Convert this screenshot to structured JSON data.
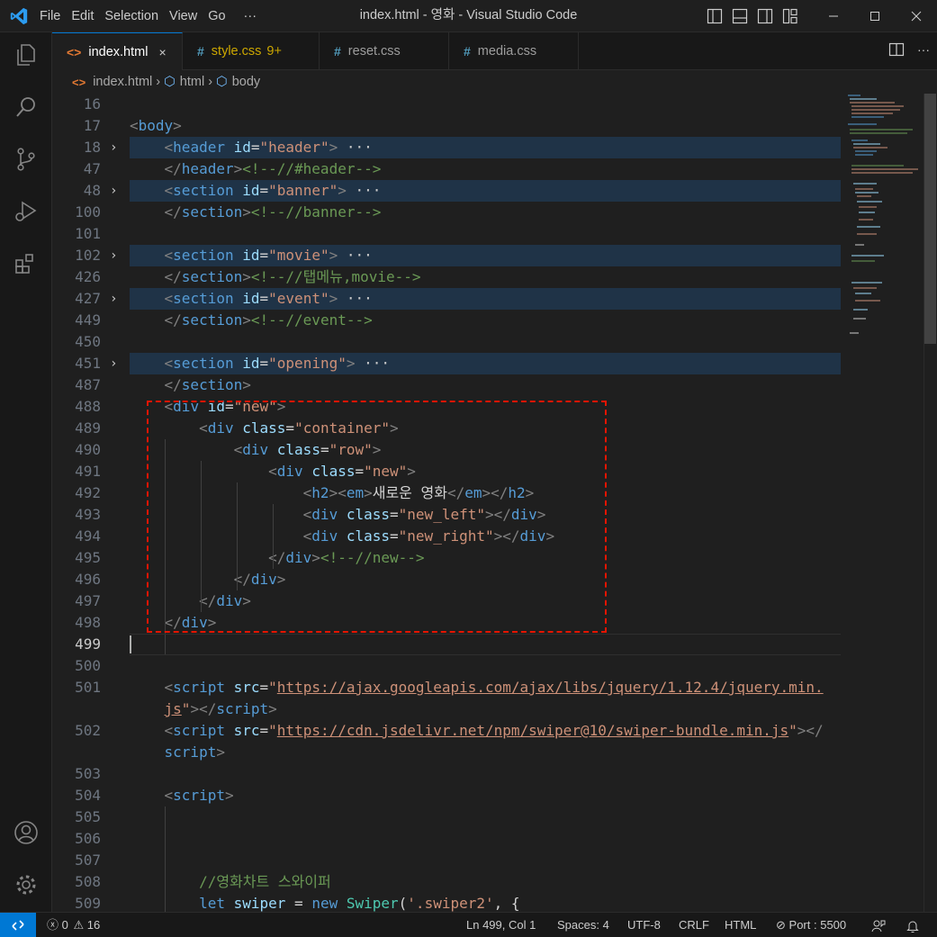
{
  "titlebar": {
    "menu": [
      "File",
      "Edit",
      "Selection",
      "View",
      "Go",
      "···"
    ],
    "title": "index.html - 영화 - Visual Studio Code"
  },
  "tabs": [
    {
      "label": "index.html",
      "icon": "<>",
      "active": true,
      "close": "×"
    },
    {
      "label": "style.css",
      "badge": "9+",
      "icon": "#",
      "active": false
    },
    {
      "label": "reset.css",
      "icon": "#",
      "active": false
    },
    {
      "label": "media.css",
      "icon": "#",
      "active": false
    }
  ],
  "breadcrumb": [
    "index.html",
    "html",
    "body"
  ],
  "lines": [
    {
      "n": "16",
      "parts": []
    },
    {
      "n": "17",
      "parts": [
        [
          "pu",
          "<"
        ],
        [
          "tg",
          "body"
        ],
        [
          "pu",
          ">"
        ]
      ]
    },
    {
      "n": "18",
      "fold": true,
      "folded": true,
      "parts": [
        [
          "tx",
          "    "
        ],
        [
          "pu",
          "<"
        ],
        [
          "tg",
          "header"
        ],
        [
          "tx",
          " "
        ],
        [
          "at",
          "id"
        ],
        [
          "tx",
          "="
        ],
        [
          "st",
          "\"header\""
        ],
        [
          "pu",
          ">"
        ],
        [
          "dots",
          " ···"
        ]
      ]
    },
    {
      "n": "47",
      "parts": [
        [
          "tx",
          "    "
        ],
        [
          "pu",
          "</"
        ],
        [
          "tg",
          "header"
        ],
        [
          "pu",
          ">"
        ],
        [
          "cm",
          "<!--//#header-->"
        ]
      ]
    },
    {
      "n": "48",
      "fold": true,
      "folded": true,
      "parts": [
        [
          "tx",
          "    "
        ],
        [
          "pu",
          "<"
        ],
        [
          "tg",
          "section"
        ],
        [
          "tx",
          " "
        ],
        [
          "at",
          "id"
        ],
        [
          "tx",
          "="
        ],
        [
          "st",
          "\"banner\""
        ],
        [
          "pu",
          ">"
        ],
        [
          "dots",
          " ···"
        ]
      ]
    },
    {
      "n": "100",
      "parts": [
        [
          "tx",
          "    "
        ],
        [
          "pu",
          "</"
        ],
        [
          "tg",
          "section"
        ],
        [
          "pu",
          ">"
        ],
        [
          "cm",
          "<!--//banner-->"
        ]
      ]
    },
    {
      "n": "101",
      "parts": []
    },
    {
      "n": "102",
      "fold": true,
      "folded": true,
      "parts": [
        [
          "tx",
          "    "
        ],
        [
          "pu",
          "<"
        ],
        [
          "tg",
          "section"
        ],
        [
          "tx",
          " "
        ],
        [
          "at",
          "id"
        ],
        [
          "tx",
          "="
        ],
        [
          "st",
          "\"movie\""
        ],
        [
          "pu",
          ">"
        ],
        [
          "dots",
          " ···"
        ]
      ]
    },
    {
      "n": "426",
      "parts": [
        [
          "tx",
          "    "
        ],
        [
          "pu",
          "</"
        ],
        [
          "tg",
          "section"
        ],
        [
          "pu",
          ">"
        ],
        [
          "cm",
          "<!--//탭메뉴,movie-->"
        ]
      ]
    },
    {
      "n": "427",
      "fold": true,
      "folded": true,
      "parts": [
        [
          "tx",
          "    "
        ],
        [
          "pu",
          "<"
        ],
        [
          "tg",
          "section"
        ],
        [
          "tx",
          " "
        ],
        [
          "at",
          "id"
        ],
        [
          "tx",
          "="
        ],
        [
          "st",
          "\"event\""
        ],
        [
          "pu",
          ">"
        ],
        [
          "dots",
          " ···"
        ]
      ]
    },
    {
      "n": "449",
      "parts": [
        [
          "tx",
          "    "
        ],
        [
          "pu",
          "</"
        ],
        [
          "tg",
          "section"
        ],
        [
          "pu",
          ">"
        ],
        [
          "cm",
          "<!--//event-->"
        ]
      ]
    },
    {
      "n": "450",
      "parts": []
    },
    {
      "n": "451",
      "fold": true,
      "folded": true,
      "parts": [
        [
          "tx",
          "    "
        ],
        [
          "pu",
          "<"
        ],
        [
          "tg",
          "section"
        ],
        [
          "tx",
          " "
        ],
        [
          "at",
          "id"
        ],
        [
          "tx",
          "="
        ],
        [
          "st",
          "\"opening\""
        ],
        [
          "pu",
          ">"
        ],
        [
          "dots",
          " ···"
        ]
      ]
    },
    {
      "n": "487",
      "parts": [
        [
          "tx",
          "    "
        ],
        [
          "pu",
          "</"
        ],
        [
          "tg",
          "section"
        ],
        [
          "pu",
          ">"
        ]
      ]
    },
    {
      "n": "488",
      "parts": [
        [
          "tx",
          "    "
        ],
        [
          "pu",
          "<"
        ],
        [
          "tg",
          "div"
        ],
        [
          "tx",
          " "
        ],
        [
          "at",
          "id"
        ],
        [
          "tx",
          "="
        ],
        [
          "st",
          "\"new\""
        ],
        [
          "pu",
          ">"
        ]
      ]
    },
    {
      "n": "489",
      "parts": [
        [
          "tx",
          "        "
        ],
        [
          "pu",
          "<"
        ],
        [
          "tg",
          "div"
        ],
        [
          "tx",
          " "
        ],
        [
          "at",
          "class"
        ],
        [
          "tx",
          "="
        ],
        [
          "st",
          "\"container\""
        ],
        [
          "pu",
          ">"
        ]
      ]
    },
    {
      "n": "490",
      "parts": [
        [
          "tx",
          "            "
        ],
        [
          "pu",
          "<"
        ],
        [
          "tg",
          "div"
        ],
        [
          "tx",
          " "
        ],
        [
          "at",
          "class"
        ],
        [
          "tx",
          "="
        ],
        [
          "st",
          "\"row\""
        ],
        [
          "pu",
          ">"
        ]
      ]
    },
    {
      "n": "491",
      "parts": [
        [
          "tx",
          "                "
        ],
        [
          "pu",
          "<"
        ],
        [
          "tg",
          "div"
        ],
        [
          "tx",
          " "
        ],
        [
          "at",
          "class"
        ],
        [
          "tx",
          "="
        ],
        [
          "st",
          "\"new\""
        ],
        [
          "pu",
          ">"
        ]
      ]
    },
    {
      "n": "492",
      "parts": [
        [
          "tx",
          "                    "
        ],
        [
          "pu",
          "<"
        ],
        [
          "tg",
          "h2"
        ],
        [
          "pu",
          "><"
        ],
        [
          "tg",
          "em"
        ],
        [
          "pu",
          ">"
        ],
        [
          "tx",
          "새로운 영화"
        ],
        [
          "pu",
          "</"
        ],
        [
          "tg",
          "em"
        ],
        [
          "pu",
          "></"
        ],
        [
          "tg",
          "h2"
        ],
        [
          "pu",
          ">"
        ]
      ]
    },
    {
      "n": "493",
      "parts": [
        [
          "tx",
          "                    "
        ],
        [
          "pu",
          "<"
        ],
        [
          "tg",
          "div"
        ],
        [
          "tx",
          " "
        ],
        [
          "at",
          "class"
        ],
        [
          "tx",
          "="
        ],
        [
          "st",
          "\"new_left\""
        ],
        [
          "pu",
          "></"
        ],
        [
          "tg",
          "div"
        ],
        [
          "pu",
          ">"
        ]
      ]
    },
    {
      "n": "494",
      "parts": [
        [
          "tx",
          "                    "
        ],
        [
          "pu",
          "<"
        ],
        [
          "tg",
          "div"
        ],
        [
          "tx",
          " "
        ],
        [
          "at",
          "class"
        ],
        [
          "tx",
          "="
        ],
        [
          "st",
          "\"new_right\""
        ],
        [
          "pu",
          "></"
        ],
        [
          "tg",
          "div"
        ],
        [
          "pu",
          ">"
        ]
      ]
    },
    {
      "n": "495",
      "parts": [
        [
          "tx",
          "                "
        ],
        [
          "pu",
          "</"
        ],
        [
          "tg",
          "div"
        ],
        [
          "pu",
          ">"
        ],
        [
          "cm",
          "<!--//new-->"
        ]
      ]
    },
    {
      "n": "496",
      "parts": [
        [
          "tx",
          "            "
        ],
        [
          "pu",
          "</"
        ],
        [
          "tg",
          "div"
        ],
        [
          "pu",
          ">"
        ]
      ]
    },
    {
      "n": "497",
      "parts": [
        [
          "tx",
          "        "
        ],
        [
          "pu",
          "</"
        ],
        [
          "tg",
          "div"
        ],
        [
          "pu",
          ">"
        ]
      ]
    },
    {
      "n": "498",
      "parts": [
        [
          "tx",
          "    "
        ],
        [
          "pu",
          "</"
        ],
        [
          "tg",
          "div"
        ],
        [
          "pu",
          ">"
        ]
      ]
    },
    {
      "n": "499",
      "current": true,
      "parts": []
    },
    {
      "n": "500",
      "parts": []
    },
    {
      "n": "501",
      "parts": [
        [
          "tx",
          "    "
        ],
        [
          "pu",
          "<"
        ],
        [
          "tg",
          "script"
        ],
        [
          "tx",
          " "
        ],
        [
          "at",
          "src"
        ],
        [
          "tx",
          "="
        ],
        [
          "st",
          "\""
        ],
        [
          "stu",
          "https://ajax.googleapis.com/ajax/libs/jquery/1.12.4/jquery.min."
        ]
      ]
    },
    {
      "n": "",
      "parts": [
        [
          "tx",
          "    "
        ],
        [
          "stu",
          "js"
        ],
        [
          "st",
          "\""
        ],
        [
          "pu",
          "></"
        ],
        [
          "tg",
          "script"
        ],
        [
          "pu",
          ">"
        ]
      ]
    },
    {
      "n": "502",
      "parts": [
        [
          "tx",
          "    "
        ],
        [
          "pu",
          "<"
        ],
        [
          "tg",
          "script"
        ],
        [
          "tx",
          " "
        ],
        [
          "at",
          "src"
        ],
        [
          "tx",
          "="
        ],
        [
          "st",
          "\""
        ],
        [
          "stu",
          "https://cdn.jsdelivr.net/npm/swiper@10/swiper-bundle.min.js"
        ],
        [
          "st",
          "\""
        ],
        [
          "pu",
          "></"
        ]
      ]
    },
    {
      "n": "",
      "parts": [
        [
          "tx",
          "    "
        ],
        [
          "tg",
          "script"
        ],
        [
          "pu",
          ">"
        ]
      ]
    },
    {
      "n": "503",
      "parts": []
    },
    {
      "n": "504",
      "parts": [
        [
          "tx",
          "    "
        ],
        [
          "pu",
          "<"
        ],
        [
          "tg",
          "script"
        ],
        [
          "pu",
          ">"
        ]
      ]
    },
    {
      "n": "505",
      "parts": []
    },
    {
      "n": "506",
      "parts": []
    },
    {
      "n": "507",
      "parts": []
    },
    {
      "n": "508",
      "parts": [
        [
          "tx",
          "        "
        ],
        [
          "cm",
          "//영화차트 스와이퍼"
        ]
      ]
    },
    {
      "n": "509",
      "parts": [
        [
          "tx",
          "        "
        ],
        [
          "kw",
          "let"
        ],
        [
          "tx",
          " "
        ],
        [
          "vr",
          "swiper"
        ],
        [
          "tx",
          " = "
        ],
        [
          "kw",
          "new"
        ],
        [
          "tx",
          " "
        ],
        [
          "fn",
          "Swiper"
        ],
        [
          "tx",
          "("
        ],
        [
          "st",
          "'.swiper2'"
        ],
        [
          "tx",
          ", {"
        ]
      ]
    }
  ],
  "status": {
    "errors": "0",
    "warnings": "16",
    "position": "Ln 499, Col 1",
    "spaces": "Spaces: 4",
    "encoding": "UTF-8",
    "eol": "CRLF",
    "language": "HTML",
    "port": "Port : 5500"
  }
}
